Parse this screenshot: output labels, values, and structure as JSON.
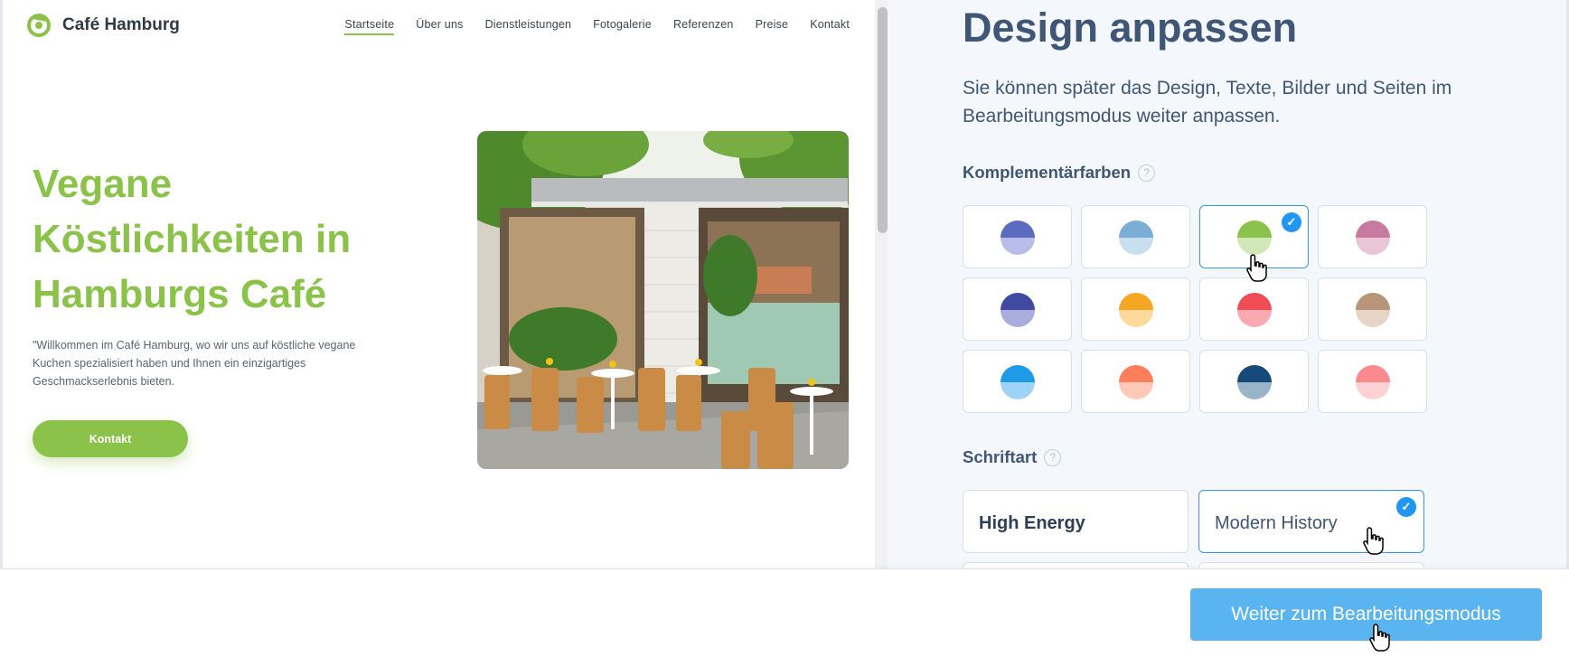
{
  "preview": {
    "site_name": "Café Hamburg",
    "nav": [
      "Startseite",
      "Über uns",
      "Dienstleistungen",
      "Fotogalerie",
      "Referenzen",
      "Preise",
      "Kontakt"
    ],
    "nav_active_index": 0,
    "hero_title": "Vegane Köstlichkeiten in Hamburgs Café",
    "hero_text": "\"Willkommen im Café Hamburg, wo wir uns auf köstliche vegane Kuchen spezialisiert haben und Ihnen ein einzigartiges Geschmackserlebnis bieten.",
    "hero_button": "Kontakt",
    "accent_color": "#8bc34a"
  },
  "settings": {
    "title": "Design anpassen",
    "subtitle": "Sie können später das Design, Texte, Bilder und Seiten im Bearbeitungsmodus weiter anpassen.",
    "colors_label": "Komplementärfarben",
    "help_glyph": "?",
    "check_glyph": "✓",
    "color_options": [
      {
        "top": "#5c6bc0",
        "bottom": "#b7bde6",
        "selected": false
      },
      {
        "top": "#7aaed6",
        "bottom": "#c8dff0",
        "selected": false
      },
      {
        "top": "#8bc34a",
        "bottom": "#d1e8b6",
        "selected": true
      },
      {
        "top": "#c97aa3",
        "bottom": "#eac5d8",
        "selected": false
      },
      {
        "top": "#3f4aa0",
        "bottom": "#a9addc",
        "selected": false
      },
      {
        "top": "#f5a623",
        "bottom": "#fdd99a",
        "selected": false
      },
      {
        "top": "#ef4c55",
        "bottom": "#f8aab0",
        "selected": false
      },
      {
        "top": "#b89478",
        "bottom": "#e6d5c6",
        "selected": false
      },
      {
        "top": "#1e9be8",
        "bottom": "#9fd2f7",
        "selected": false
      },
      {
        "top": "#ff7f5c",
        "bottom": "#ffc9b8",
        "selected": false
      },
      {
        "top": "#154a7a",
        "bottom": "#9bb3c8",
        "selected": false
      },
      {
        "top": "#fb8a8f",
        "bottom": "#fdd2d4",
        "selected": false
      }
    ],
    "font_label": "Schriftart",
    "font_options": [
      {
        "name": "High Energy",
        "selected": false
      },
      {
        "name": "Modern History",
        "selected": true
      }
    ]
  },
  "bottom_bar": {
    "continue_label": "Weiter zum Bearbeitungsmodus",
    "button_color": "#5ab4ef"
  }
}
